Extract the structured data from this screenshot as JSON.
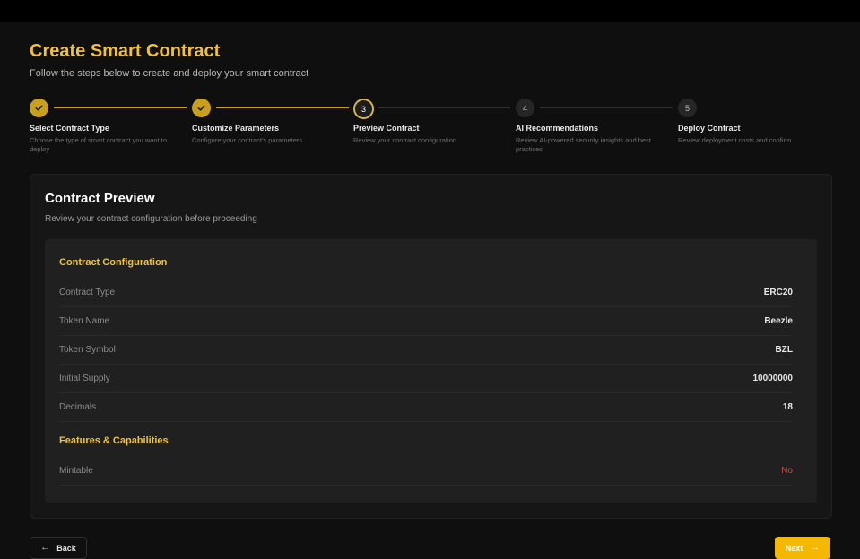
{
  "header": {
    "title": "Create Smart Contract",
    "subtitle": "Follow the steps below to create and deploy your smart contract"
  },
  "steps": [
    {
      "number": "1",
      "title": "Select Contract Type",
      "desc": "Choose the type of smart contract you want to deploy",
      "state": "done"
    },
    {
      "number": "2",
      "title": "Customize Parameters",
      "desc": "Configure your contract's parameters",
      "state": "done"
    },
    {
      "number": "3",
      "title": "Preview Contract",
      "desc": "Review your contract configuration",
      "state": "active"
    },
    {
      "number": "4",
      "title": "AI Recommendations",
      "desc": "Review AI-powered security insights and best practices",
      "state": "pending"
    },
    {
      "number": "5",
      "title": "Deploy Contract",
      "desc": "Review deployment costs and confirm",
      "state": "pending"
    }
  ],
  "preview": {
    "title": "Contract Preview",
    "subtitle": "Review your contract configuration before proceeding",
    "config_heading": "Contract Configuration",
    "config": [
      {
        "label": "Contract Type",
        "value": "ERC20"
      },
      {
        "label": "Token Name",
        "value": "Beezle"
      },
      {
        "label": "Token Symbol",
        "value": "BZL"
      },
      {
        "label": "Initial Supply",
        "value": "10000000"
      },
      {
        "label": "Decimals",
        "value": "18"
      }
    ],
    "features_heading": "Features & Capabilities",
    "features": [
      {
        "label": "Mintable",
        "value": "No"
      }
    ]
  },
  "footer": {
    "back_label": "Back",
    "next_label": "Next",
    "back_icon": "arrow-left-icon",
    "next_icon": "arrow-right-icon"
  },
  "colors": {
    "accent": "#f2c230",
    "button": "#f5b800",
    "negative": "#d9443a"
  }
}
